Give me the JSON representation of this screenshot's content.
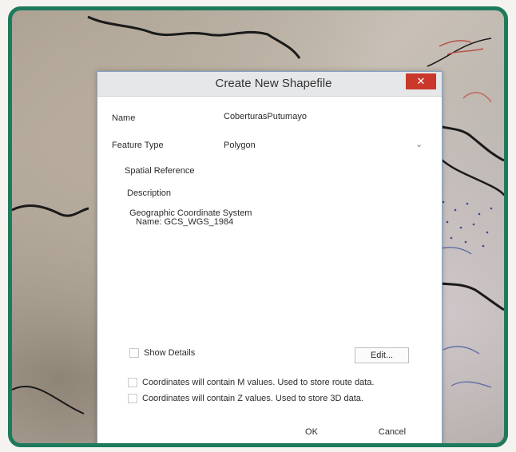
{
  "dialog": {
    "title": "Create New Shapefile",
    "close_label": "✕",
    "name_label": "Name",
    "name_value": "CoberturasPutumayo",
    "feature_type_label": "Feature Type",
    "feature_type_value": "Polygon",
    "spatial_reference_label": "Spatial Reference",
    "description_label": "Description",
    "description_line1": "Geographic Coordinate System",
    "description_line2": "Name: GCS_WGS_1984",
    "show_details_label": "Show Details",
    "edit_button_label": "Edit...",
    "m_values_label": "Coordinates will contain M values. Used to store route data.",
    "z_values_label": "Coordinates will contain Z values. Used to store 3D data.",
    "ok_label": "OK",
    "cancel_label": "Cancel"
  },
  "colors": {
    "frame_border": "#1e7a5c",
    "close_button": "#c9382b",
    "dialog_border": "#7fa3c7"
  },
  "icons": {
    "close": "close-icon",
    "dropdown": "chevron-down-icon"
  }
}
